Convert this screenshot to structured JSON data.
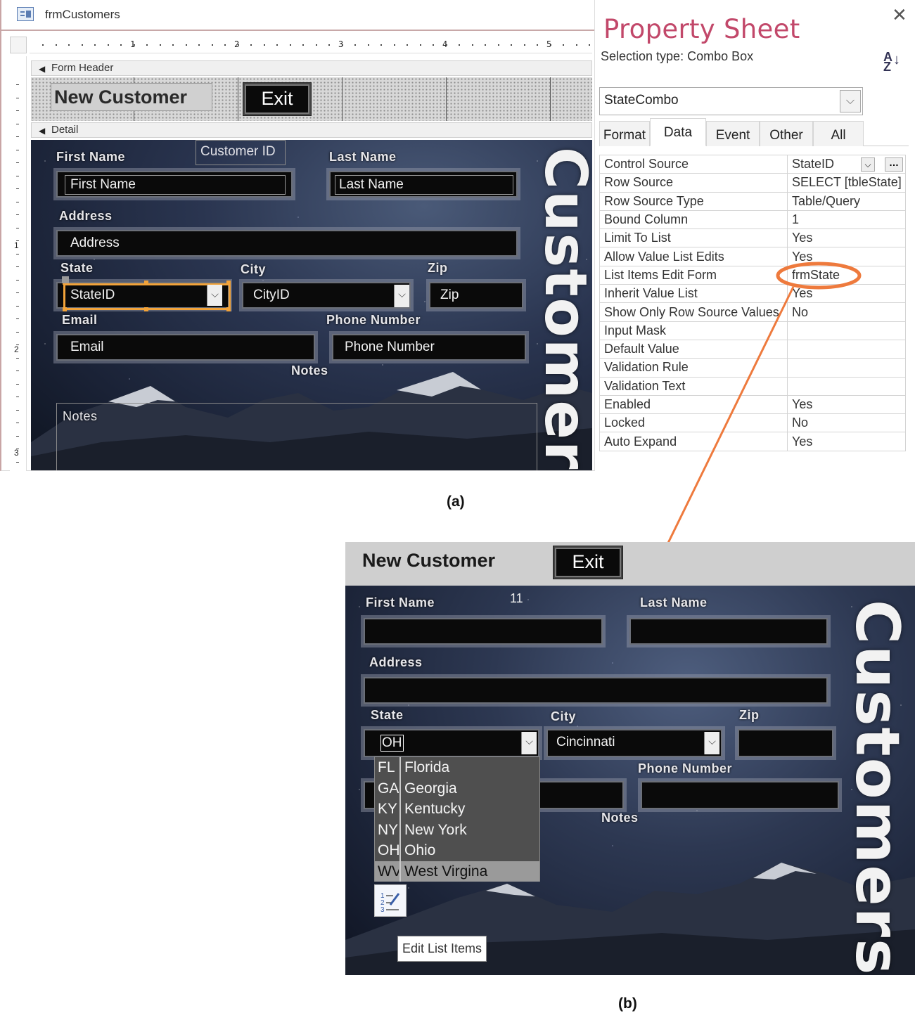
{
  "design_window": {
    "title": "frmCustomers",
    "ruler_numbers": [
      "1",
      "2",
      "3",
      "4",
      "5"
    ],
    "vertical_ruler_numbers": [
      "1",
      "2",
      "3"
    ],
    "section_form_header": "Form Header",
    "section_detail": "Detail",
    "header_title": "New Customer",
    "exit_label": "Exit",
    "labels": {
      "first_name": "First Name",
      "customer_id": "Customer ID",
      "last_name": "Last Name",
      "address": "Address",
      "state": "State",
      "city": "City",
      "zip": "Zip",
      "email": "Email",
      "phone": "Phone Number",
      "notes": "Notes"
    },
    "fields": {
      "first_name": "First Name",
      "last_name": "Last Name",
      "address": "Address",
      "state": "StateID",
      "city": "CityID",
      "zip": "Zip",
      "email": "Email",
      "phone": "Phone Number",
      "notes": "Notes"
    },
    "vertical_title": "Customers"
  },
  "property_sheet": {
    "title": "Property Sheet",
    "selection_type": "Selection type:  Combo Box",
    "sort_icon": "sort-az-icon",
    "object_combo": "StateCombo",
    "tabs": [
      "Format",
      "Data",
      "Event",
      "Other",
      "All"
    ],
    "active_tab": "Data",
    "properties": [
      {
        "name": "Control Source",
        "value": "StateID"
      },
      {
        "name": "Row Source",
        "value": "SELECT [tbleState]"
      },
      {
        "name": "Row Source Type",
        "value": "Table/Query"
      },
      {
        "name": "Bound Column",
        "value": "1"
      },
      {
        "name": "Limit To List",
        "value": "Yes"
      },
      {
        "name": "Allow Value List Edits",
        "value": "Yes"
      },
      {
        "name": "List Items Edit Form",
        "value": "frmState"
      },
      {
        "name": "Inherit Value List",
        "value": "Yes"
      },
      {
        "name": "Show Only Row Source Values",
        "value": "No"
      },
      {
        "name": "Input Mask",
        "value": ""
      },
      {
        "name": "Default Value",
        "value": ""
      },
      {
        "name": "Validation Rule",
        "value": ""
      },
      {
        "name": "Validation Text",
        "value": ""
      },
      {
        "name": "Enabled",
        "value": "Yes"
      },
      {
        "name": "Locked",
        "value": "No"
      },
      {
        "name": "Auto Expand",
        "value": "Yes"
      }
    ],
    "highlight_color": "#ee7a3d"
  },
  "captions": {
    "a": "(a)",
    "b": "(b)"
  },
  "form_view": {
    "header_title": "New Customer",
    "exit_label": "Exit",
    "customer_id_value": "11",
    "labels": {
      "first_name": "First Name",
      "last_name": "Last Name",
      "address": "Address",
      "state": "State",
      "city": "City",
      "zip": "Zip",
      "phone": "Phone Number",
      "notes": "Notes"
    },
    "state_value": "OH",
    "city_value": "Cincinnati",
    "state_options": [
      {
        "code": "FL",
        "name": "Florida"
      },
      {
        "code": "GA",
        "name": "Georgia"
      },
      {
        "code": "KY",
        "name": "Kentucky"
      },
      {
        "code": "NY",
        "name": "New York"
      },
      {
        "code": "OH",
        "name": "Ohio"
      },
      {
        "code": "WV",
        "name": "West Virgina"
      }
    ],
    "selected_option": "West Virgina",
    "edit_button_icon": "edit-list-icon",
    "tooltip": "Edit List Items",
    "vertical_title": "Customers"
  }
}
